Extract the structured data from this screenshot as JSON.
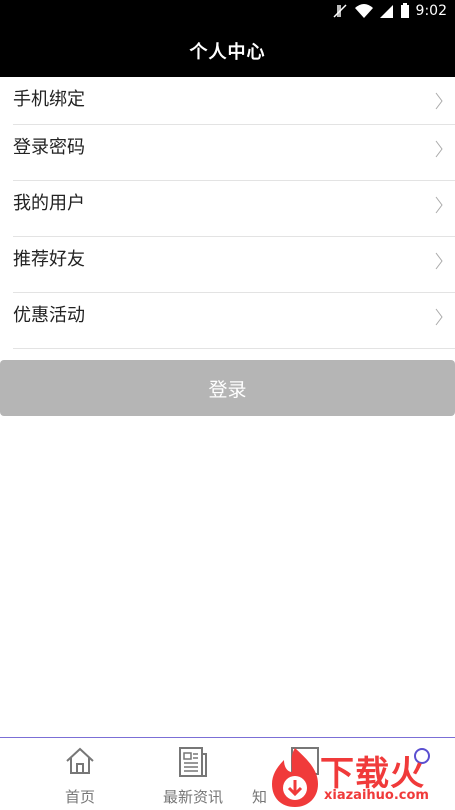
{
  "status": {
    "time": "9:02"
  },
  "header": {
    "title": "个人中心"
  },
  "menu": {
    "items": [
      {
        "label": "手机绑定"
      },
      {
        "label": "登录密码"
      },
      {
        "label": "我的用户"
      },
      {
        "label": "推荐好友"
      },
      {
        "label": "优惠活动"
      }
    ]
  },
  "login": {
    "label": "登录"
  },
  "tabs": [
    {
      "label": "首页",
      "icon": "home-icon"
    },
    {
      "label": "最新资讯",
      "icon": "news-icon"
    },
    {
      "label": "知",
      "icon": "knowledge-icon"
    },
    {
      "label": "",
      "icon": "profile-icon"
    }
  ],
  "watermark": {
    "text": "下载火",
    "sub": "xiazaihuo.com"
  }
}
